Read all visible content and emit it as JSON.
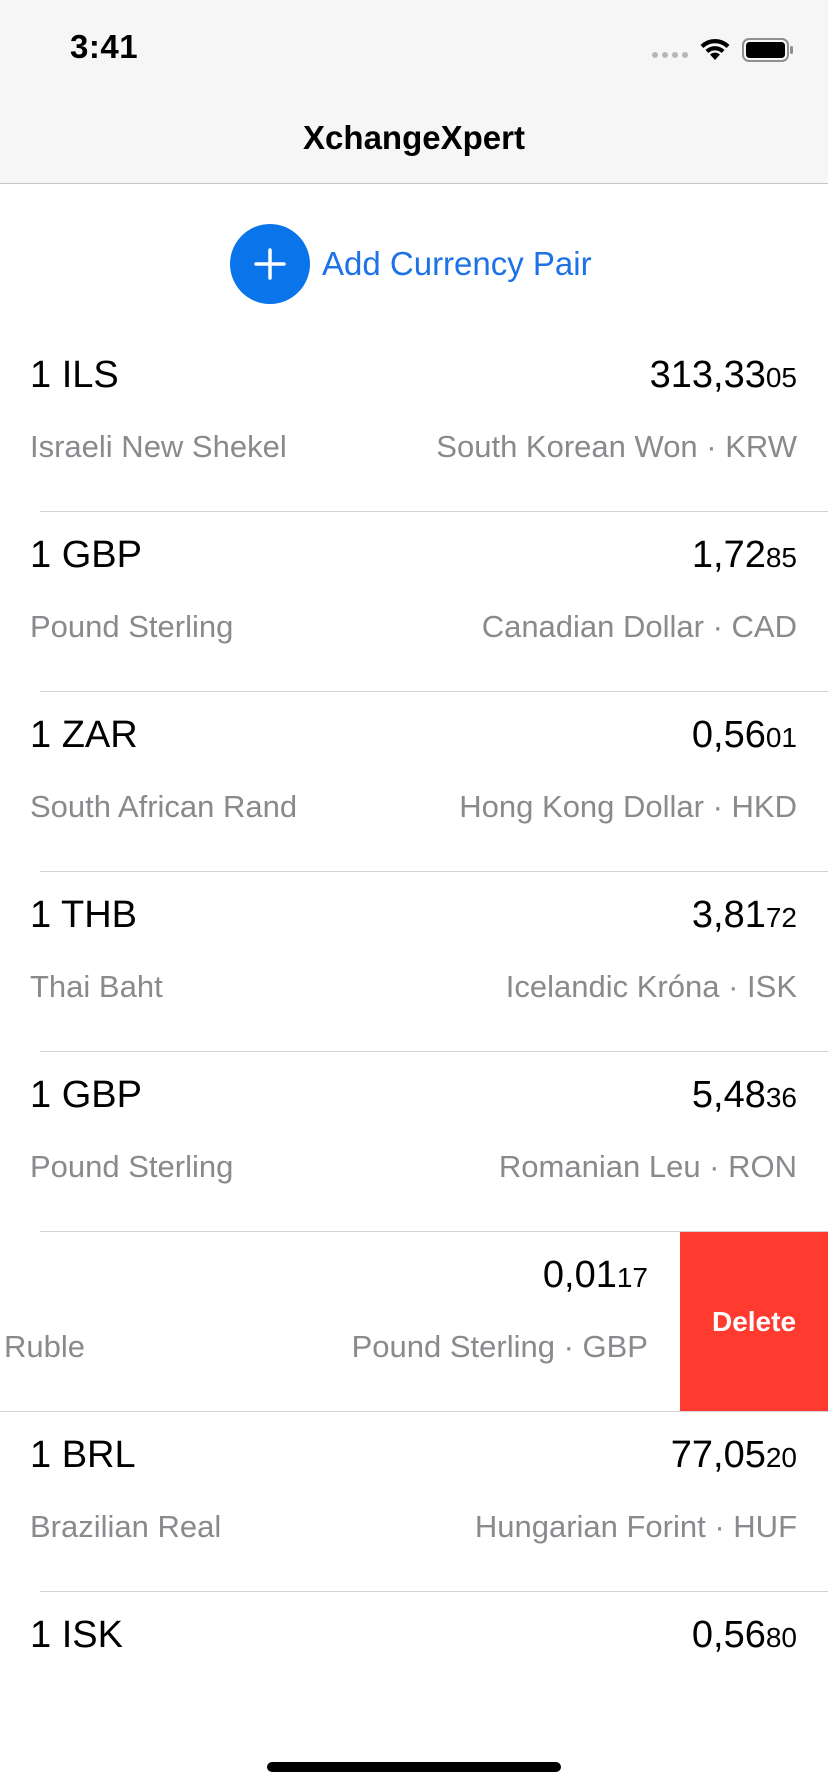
{
  "status_bar": {
    "time": "3:41"
  },
  "nav": {
    "title": "XchangeXpert"
  },
  "add_button": {
    "label": "Add Currency Pair"
  },
  "pairs": [
    {
      "base": "1 ILS",
      "rate_main": "313,33",
      "rate_small": "05",
      "base_name": "Israeli New Shekel",
      "quote": "South Korean Won · KRW"
    },
    {
      "base": "1 GBP",
      "rate_main": "1,72",
      "rate_small": "85",
      "base_name": "Pound Sterling",
      "quote": "Canadian Dollar · CAD"
    },
    {
      "base": "1 ZAR",
      "rate_main": "0,56",
      "rate_small": "01",
      "base_name": "South African Rand",
      "quote": "Hong Kong Dollar · HKD"
    },
    {
      "base": "1 THB",
      "rate_main": "3,81",
      "rate_small": "72",
      "base_name": "Thai Baht",
      "quote": "Icelandic Króna · ISK"
    },
    {
      "base": "1 GBP",
      "rate_main": "5,48",
      "rate_small": "36",
      "base_name": "Pound Sterling",
      "quote": "Romanian Leu · RON"
    },
    {
      "rate_main": "0,01",
      "rate_small": "17",
      "base_name": "Ruble",
      "quote": "Pound Sterling · GBP",
      "delete_label": "Delete"
    },
    {
      "base": "1 BRL",
      "rate_main": "77,05",
      "rate_small": "20",
      "base_name": "Brazilian Real",
      "quote": "Hungarian Forint · HUF"
    },
    {
      "base": "1 ISK",
      "rate_main": "0,56",
      "rate_small": "80"
    }
  ],
  "colors": {
    "accent": "#0a74eb",
    "delete": "#ff3b30",
    "secondary_text": "#8a8a8e"
  },
  "icons": [
    "plus-icon",
    "wifi-icon",
    "battery-icon",
    "cellular-signal-icon"
  ]
}
